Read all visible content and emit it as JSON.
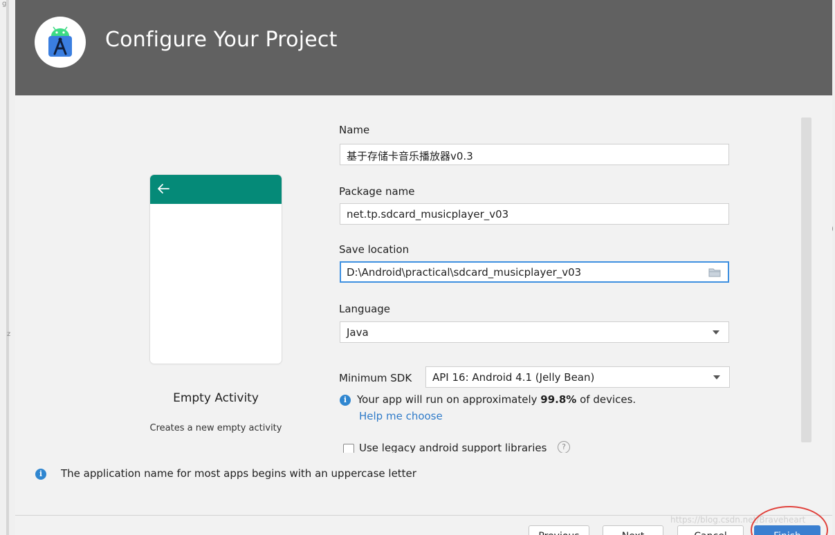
{
  "header": {
    "title": "Configure Your Project"
  },
  "template": {
    "name": "Empty Activity",
    "description": "Creates a new empty activity"
  },
  "form": {
    "name_label": "Name",
    "name_value": "基于存储卡音乐播放器v0.3",
    "package_label": "Package name",
    "package_value": "net.tp.sdcard_musicplayer_v03",
    "location_label": "Save location",
    "location_value": "D:\\Android\\practical\\sdcard_musicplayer_v03",
    "language_label": "Language",
    "language_value": "Java",
    "min_sdk_label": "Minimum SDK",
    "min_sdk_value": "API 16: Android 4.1 (Jelly Bean)",
    "coverage_prefix": "Your app will run on approximately ",
    "coverage_percent": "99.8%",
    "coverage_suffix": " of devices.",
    "help_link": "Help me choose",
    "legacy_label": "Use legacy android support libraries",
    "help_icon_glyph": "?"
  },
  "bottom_info": "The application name for most apps begins with an uppercase letter",
  "buttons": {
    "previous": "Previous",
    "next": "Next",
    "cancel": "Cancel",
    "finish": "Finish"
  },
  "watermark": "https://blog.csdn.net/Braveheart",
  "colors": {
    "header_bg": "#616161",
    "phone_bar": "#058a78",
    "accent": "#3a7fd0",
    "link": "#2f7bc9",
    "info": "#2f86d0",
    "highlight": "#e0403a"
  },
  "icons": [
    "android-studio-logo-icon",
    "back-arrow-icon",
    "folder-icon",
    "chevron-down-icon",
    "info-icon",
    "help-icon"
  ]
}
